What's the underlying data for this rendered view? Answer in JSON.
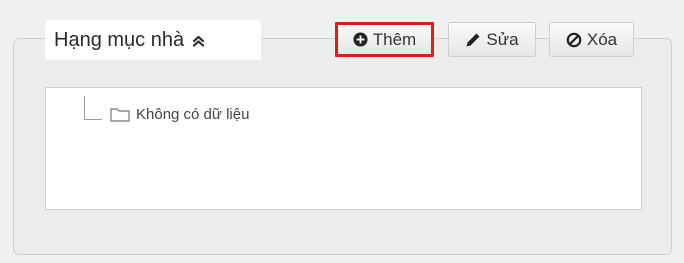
{
  "panel": {
    "title": "Hạng mục nhà"
  },
  "toolbar": {
    "add_label": "Thêm",
    "edit_label": "Sửa",
    "delete_label": "Xóa",
    "highlight_color": "#e21b1b"
  },
  "tree": {
    "empty_label": "Không có dữ liệu"
  },
  "icons": {
    "collapse": "double-chevron-up-icon",
    "add": "plus-circle-icon",
    "edit": "pencil-icon",
    "delete": "ban-icon",
    "folder": "folder-icon"
  }
}
